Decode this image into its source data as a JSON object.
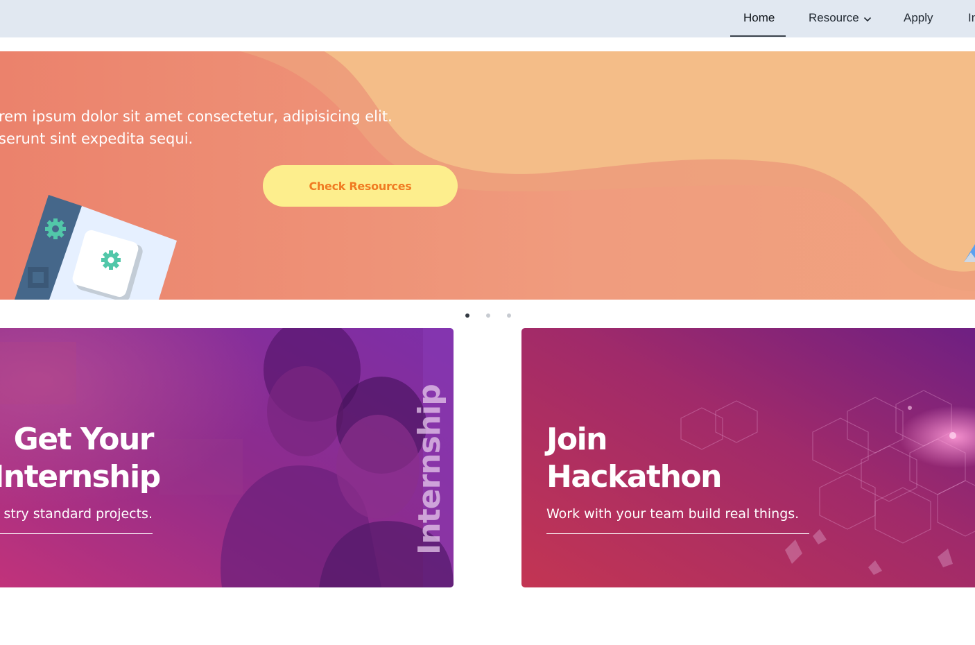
{
  "nav": {
    "items": [
      {
        "label": "Home",
        "active": true
      },
      {
        "label": "Resource",
        "has_dropdown": true
      },
      {
        "label": "Apply"
      },
      {
        "label": "In"
      }
    ]
  },
  "hero": {
    "text_line1": "rem ipsum dolor sit amet consectetur, adipisicing elit.",
    "text_line2": "serunt sint expedita sequi.",
    "cta_label": "Check Resources",
    "colors": {
      "primary": "#ec8a6e",
      "secondary": "#f4bd88",
      "button": "#fdee8d",
      "button_text": "#f07b22"
    }
  },
  "carousel": {
    "dot_count": 3,
    "active_index": 0
  },
  "cards": {
    "internship": {
      "title_line1": "Get Your",
      "title_line2": "Internship",
      "subtitle": "stry standard projects.",
      "vertical_label": "Internship"
    },
    "hackathon": {
      "title_line1": "Join",
      "title_line2": "Hackathon",
      "subtitle": "Work with your team build real things."
    }
  }
}
